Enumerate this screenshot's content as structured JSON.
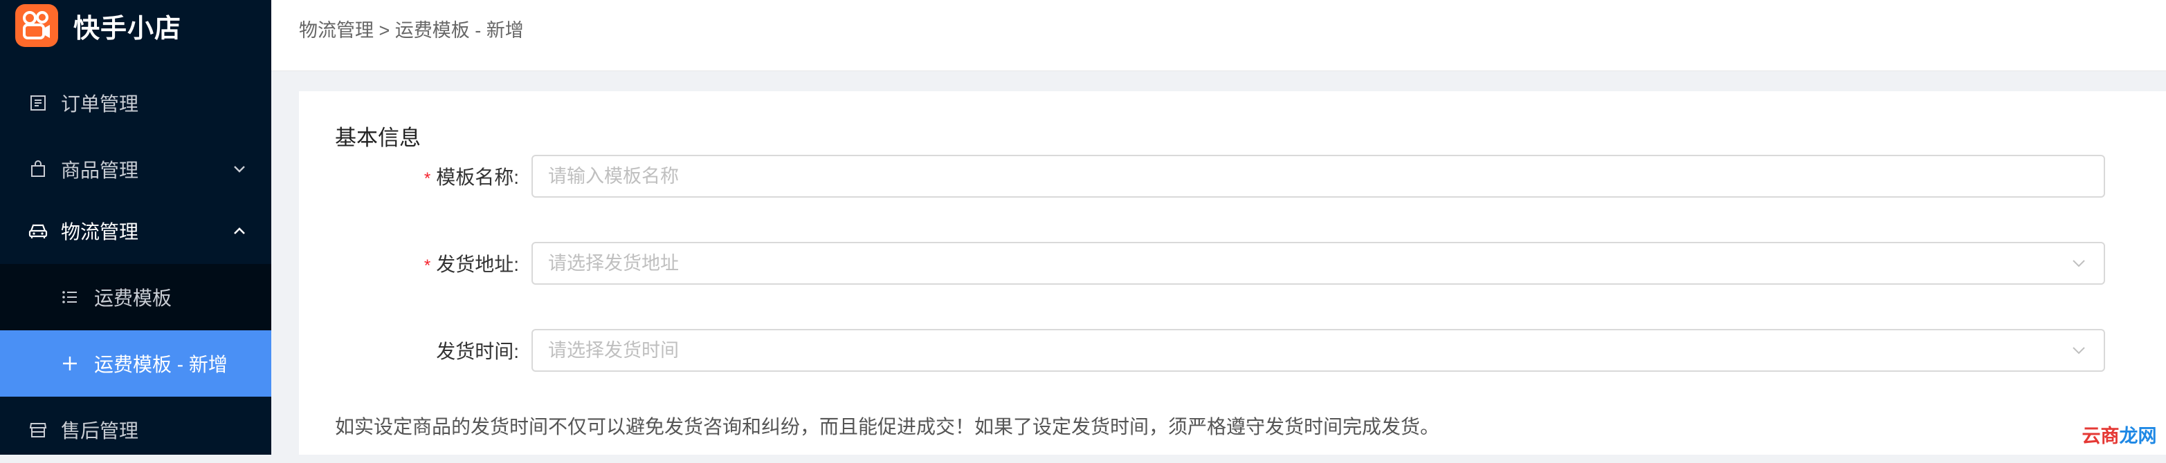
{
  "app": {
    "title": "快手小店"
  },
  "sidebar": {
    "items": [
      {
        "label": "订单管理",
        "icon": "order-list-icon"
      },
      {
        "label": "商品管理",
        "icon": "shopping-bag-icon",
        "arrow": "chevron-down-icon"
      },
      {
        "label": "物流管理",
        "icon": "car-icon",
        "arrow": "chevron-up-icon"
      },
      {
        "label": "售后管理",
        "icon": "store-icon"
      }
    ],
    "subitems": [
      {
        "label": "运费模板",
        "icon": "list-icon"
      },
      {
        "label": "运费模板 - 新增",
        "icon": "plus-icon",
        "active": true
      }
    ]
  },
  "header": {
    "breadcrumb": "物流管理 > 运费模板 - 新增"
  },
  "form": {
    "section_title": "基本信息",
    "template_name": {
      "label": "模板名称:",
      "placeholder": "请输入模板名称",
      "required": true
    },
    "ship_address": {
      "label": "发货地址:",
      "placeholder": "请选择发货地址",
      "required": true
    },
    "ship_time": {
      "label": "发货时间:",
      "placeholder": "请选择发货时间",
      "required": false
    },
    "required_mark": "*",
    "note": "如实设定商品的发货时间不仅可以避免发货咨询和纠纷，而且能促进成交！如果了设定发货时间，须严格遵守发货时间完成发货。"
  },
  "watermark": {
    "part1": "云商",
    "part2": "龙网"
  },
  "colors": {
    "sidebar_bg": "#001529",
    "submenu_bg": "#000c17",
    "active": "#4a90f5",
    "brand": "#ff6a2b",
    "required": "#f5222d"
  }
}
